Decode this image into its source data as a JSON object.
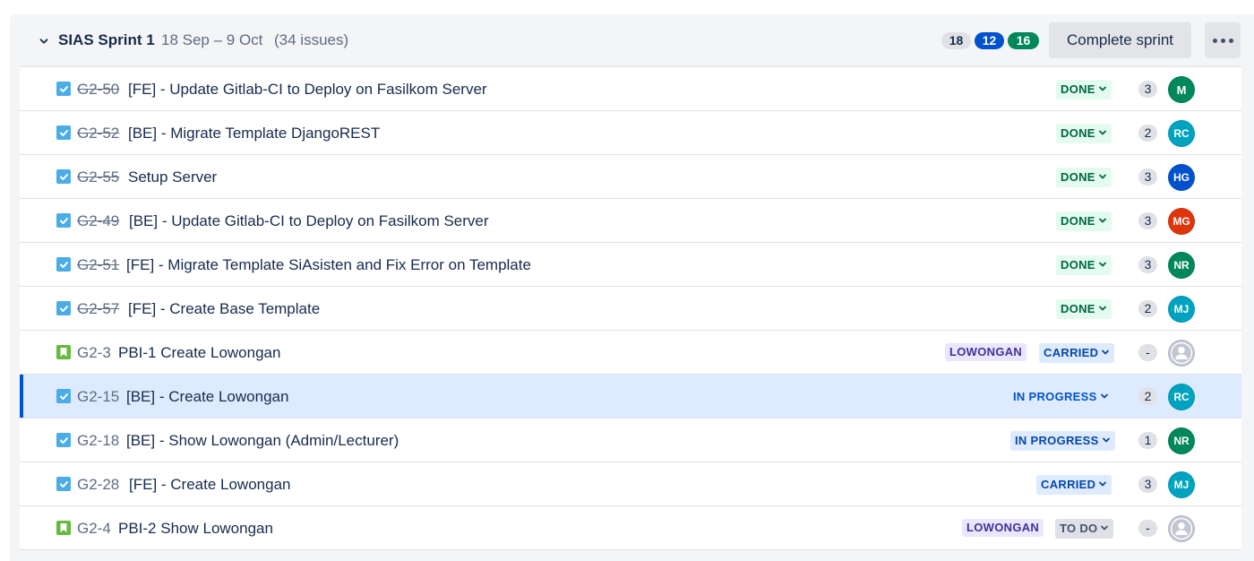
{
  "sprint": {
    "name": "SIAS Sprint 1",
    "dates": "18 Sep – 9 Oct",
    "issue_count": "(34 issues)",
    "counts": {
      "todo": "18",
      "in_progress": "12",
      "done": "16"
    },
    "complete_label": "Complete sprint"
  },
  "colors": {
    "done_pill": "#00875a",
    "progress_pill": "#0052cc",
    "todo_pill": "#dfe1e6",
    "selected_row": "#deebff"
  },
  "issues": [
    {
      "key": "G2-50",
      "summary": "[FE] - Update Gitlab-CI to Deploy on Fasilkom Server",
      "type": "task",
      "resolved": true,
      "epic": "",
      "status": "DONE",
      "estimate": "3",
      "assignee": "M",
      "avatar_color": "#00875a"
    },
    {
      "key": "G2-52",
      "summary": "[BE] - Migrate Template DjangoREST",
      "type": "task",
      "resolved": true,
      "epic": "",
      "status": "DONE",
      "estimate": "2",
      "assignee": "RC",
      "avatar_color": "#00a3bf"
    },
    {
      "key": "G2-55",
      "summary": "Setup Server",
      "type": "task",
      "resolved": true,
      "epic": "",
      "status": "DONE",
      "estimate": "3",
      "assignee": "HG",
      "avatar_color": "#0052cc"
    },
    {
      "key": "G2-49",
      "summary": "[BE] - Update Gitlab-CI to Deploy on Fasilkom Server",
      "type": "task",
      "resolved": true,
      "epic": "",
      "status": "DONE",
      "estimate": "3",
      "assignee": "MG",
      "avatar_color": "#de350b"
    },
    {
      "key": "G2-51",
      "summary": "[FE] - Migrate Template SiAsisten and Fix Error on Template",
      "type": "task",
      "resolved": true,
      "epic": "",
      "status": "DONE",
      "estimate": "3",
      "assignee": "NR",
      "avatar_color": "#00875a"
    },
    {
      "key": "G2-57",
      "summary": "[FE] - Create Base Template",
      "type": "task",
      "resolved": true,
      "epic": "",
      "status": "DONE",
      "estimate": "2",
      "assignee": "MJ",
      "avatar_color": "#00a3bf"
    },
    {
      "key": "G2-3",
      "summary": "PBI-1 Create Lowongan",
      "type": "story",
      "resolved": false,
      "epic": "LOWONGAN",
      "status": "CARRIED",
      "estimate": "-",
      "assignee": "",
      "avatar_color": "#c1c7d0"
    },
    {
      "key": "G2-15",
      "summary": "[BE] - Create Lowongan",
      "type": "task",
      "resolved": false,
      "epic": "",
      "status": "IN PROGRESS",
      "estimate": "2",
      "assignee": "RC",
      "avatar_color": "#00a3bf",
      "selected": true
    },
    {
      "key": "G2-18",
      "summary": "[BE] - Show Lowongan (Admin/Lecturer)",
      "type": "task",
      "resolved": false,
      "epic": "",
      "status": "IN PROGRESS",
      "estimate": "1",
      "assignee": "NR",
      "avatar_color": "#00875a"
    },
    {
      "key": "G2-28",
      "summary": "[FE] - Create Lowongan",
      "type": "task",
      "resolved": false,
      "epic": "",
      "status": "CARRIED",
      "estimate": "3",
      "assignee": "MJ",
      "avatar_color": "#00a3bf"
    },
    {
      "key": "G2-4",
      "summary": "PBI-2 Show Lowongan",
      "type": "story",
      "resolved": false,
      "epic": "LOWONGAN",
      "status": "TO DO",
      "estimate": "-",
      "assignee": "",
      "avatar_color": "#c1c7d0"
    }
  ]
}
